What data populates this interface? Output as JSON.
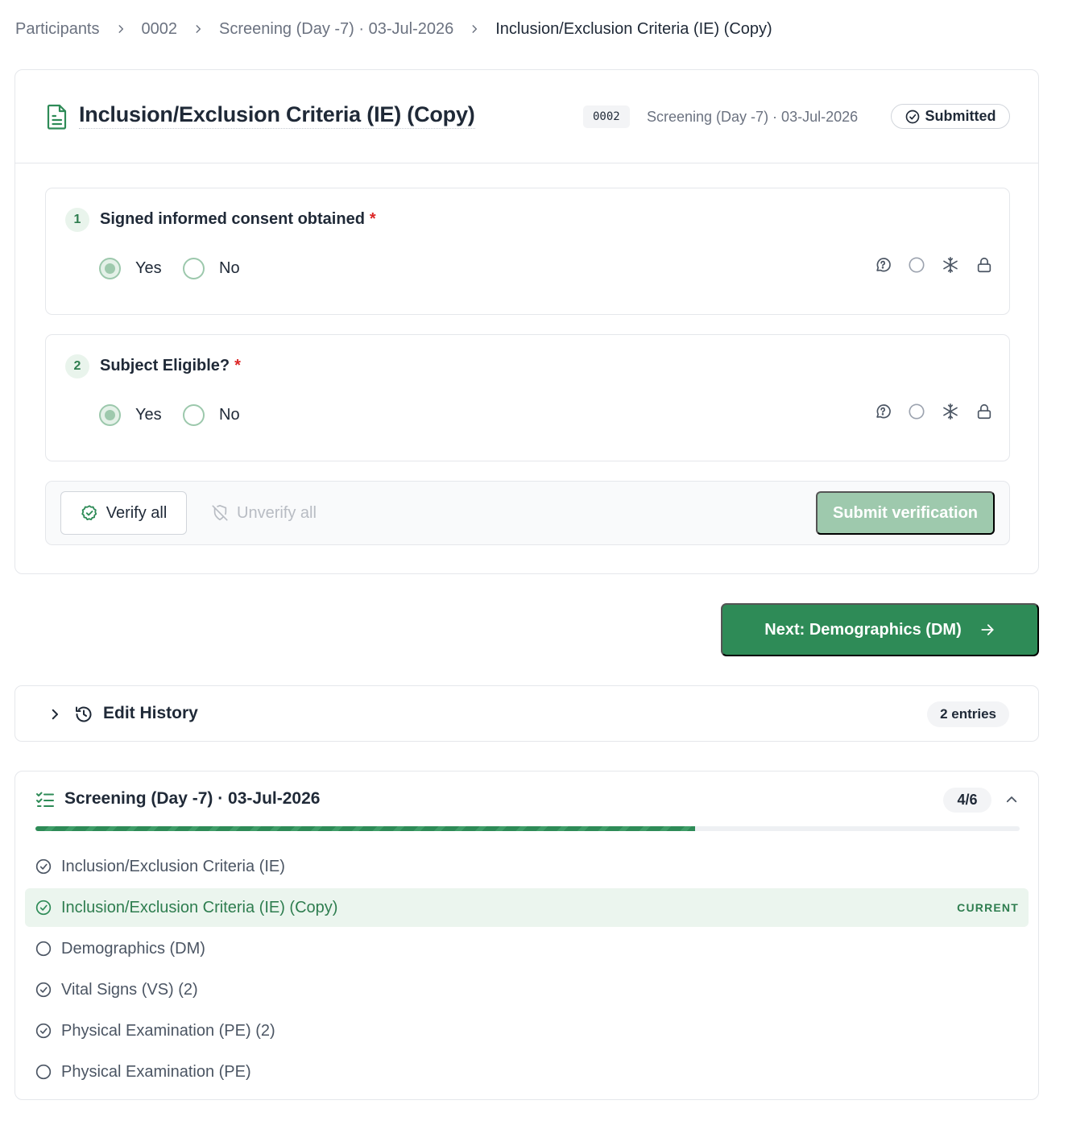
{
  "breadcrumb": {
    "items": [
      "Participants",
      "0002",
      "Screening (Day -7) · 03-Jul-2026",
      "Inclusion/Exclusion Criteria (IE) (Copy)"
    ]
  },
  "form": {
    "title": "Inclusion/Exclusion Criteria (IE) (Copy)",
    "participant_id": "0002",
    "visit_label": "Screening (Day -7) · 03-Jul-2026",
    "status": "Submitted",
    "questions": [
      {
        "number": "1",
        "label": "Signed informed consent obtained",
        "required_mark": "*",
        "options": [
          "Yes",
          "No"
        ],
        "selected": "Yes"
      },
      {
        "number": "2",
        "label": "Subject Eligible?",
        "required_mark": "*",
        "options": [
          "Yes",
          "No"
        ],
        "selected": "Yes"
      }
    ],
    "field_tools": [
      "query-icon",
      "verify-circle-icon",
      "freeze-icon",
      "lock-icon"
    ],
    "verify_all_label": "Verify all",
    "unverify_all_label": "Unverify all",
    "submit_verification_label": "Submit verification"
  },
  "next_button": {
    "label": "Next: Demographics (DM)"
  },
  "edit_history": {
    "label": "Edit History",
    "count_label": "2 entries"
  },
  "visit": {
    "title": "Screening (Day -7) · 03-Jul-2026",
    "progress_label": "4/6",
    "progress_fraction": 0.67,
    "current_tag": "CURRENT",
    "forms": [
      {
        "name": "Inclusion/Exclusion Criteria (IE)",
        "status": "complete",
        "current": false
      },
      {
        "name": "Inclusion/Exclusion Criteria (IE) (Copy)",
        "status": "complete",
        "current": true
      },
      {
        "name": "Demographics (DM)",
        "status": "empty",
        "current": false
      },
      {
        "name": "Vital Signs (VS) (2)",
        "status": "complete",
        "current": false
      },
      {
        "name": "Physical Examination (PE) (2)",
        "status": "complete",
        "current": false
      },
      {
        "name": "Physical Examination (PE)",
        "status": "empty",
        "current": false
      }
    ]
  },
  "colors": {
    "brand_green": "#2e8b57",
    "radio_green": "#9ec9ad",
    "current_bg": "#ebf5ee",
    "required_red": "#dc2626"
  }
}
